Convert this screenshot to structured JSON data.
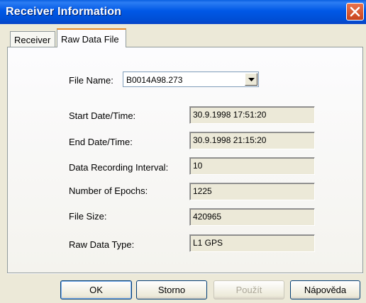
{
  "window": {
    "title": "Receiver Information",
    "close_icon": "close-icon"
  },
  "tabs": [
    {
      "label": "Receiver",
      "active": false
    },
    {
      "label": "Raw Data File",
      "active": true
    }
  ],
  "file_name": {
    "label": "File Name:",
    "value": "B0014A98.273"
  },
  "fields": [
    {
      "label": "Start Date/Time:",
      "value": "30.9.1998 17:51:20"
    },
    {
      "label": "End Date/Time:",
      "value": "30.9.1998 21:15:20"
    },
    {
      "label": "Data Recording Interval:",
      "value": "10"
    },
    {
      "label": "Number of Epochs:",
      "value": "1225"
    },
    {
      "label": "File Size:",
      "value": "420965"
    },
    {
      "label": "Raw Data Type:",
      "value": "L1 GPS"
    }
  ],
  "buttons": {
    "ok": "OK",
    "cancel": "Storno",
    "apply": "Použít",
    "help": "Nápověda"
  },
  "colors": {
    "titlebar": "#0058e6",
    "accent_tab": "#e68b2c",
    "close": "#c8441d"
  }
}
